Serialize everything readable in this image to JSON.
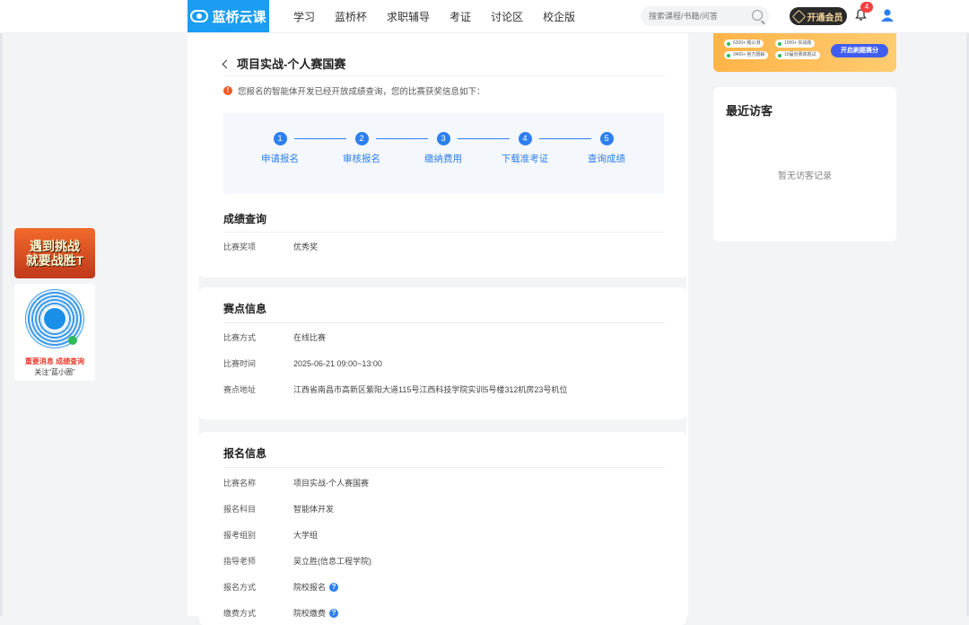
{
  "header": {
    "logo": "蓝桥云课",
    "nav": [
      "学习",
      "蓝桥杯",
      "求职辅导",
      "考证",
      "讨论区",
      "校企版"
    ],
    "search_placeholder": "搜索课程/书籍/问答",
    "vip_label": "开通会员",
    "notification_count": "4"
  },
  "left_float": {
    "promo_line1": "遇到挑战",
    "promo_line2": "就要战胜T",
    "qr_line1": "重要消息 成绩查询",
    "qr_line2": "关注“蓝小圈”"
  },
  "page": {
    "back_title": "项目实战-个人赛国赛",
    "notice": "您报名的智能体开发已经开放成绩查询，您的比赛获奖信息如下：",
    "steps": [
      {
        "num": "1",
        "label": "申请报名"
      },
      {
        "num": "2",
        "label": "审核报名"
      },
      {
        "num": "3",
        "label": "缴纳费用"
      },
      {
        "num": "4",
        "label": "下载准考证"
      },
      {
        "num": "5",
        "label": "查询成绩"
      }
    ],
    "score": {
      "title": "成绩查询",
      "rows": [
        {
          "k": "比赛奖项",
          "v": "优秀奖"
        }
      ]
    },
    "venue": {
      "title": "赛点信息",
      "rows": [
        {
          "k": "比赛方式",
          "v": "在线比赛"
        },
        {
          "k": "比赛时间",
          "v": "2025-06-21 09:00~13:00"
        },
        {
          "k": "赛点地址",
          "v": "江西省南昌市高新区紫阳大道115号江西科技学院实训5号楼312机房23号机位"
        }
      ]
    },
    "signup": {
      "title": "报名信息",
      "rows": [
        {
          "k": "比赛名称",
          "v": "项目实战-个人赛国赛"
        },
        {
          "k": "报名科目",
          "v": "智能体开发"
        },
        {
          "k": "报考组别",
          "v": "大学组"
        },
        {
          "k": "指导老师",
          "v": "吴立胜(信息工程学院)"
        },
        {
          "k": "报名方式",
          "v": "院校报名"
        },
        {
          "k": "缴费方式",
          "v": "院校缴费"
        }
      ]
    }
  },
  "sidebar": {
    "banner": {
      "pills": [
        "6200+ 题公测",
        "1000+ 实战题",
        "3400+ 官方题解",
        "10届省赛真题试",
        "开启刷题赛分"
      ]
    },
    "visitors_title": "最近访客",
    "visitors_empty": "暂无访客记录"
  },
  "colors": {
    "accent": "#2d7ff0",
    "brand": "#1a9df2",
    "warn": "#f05a24"
  }
}
